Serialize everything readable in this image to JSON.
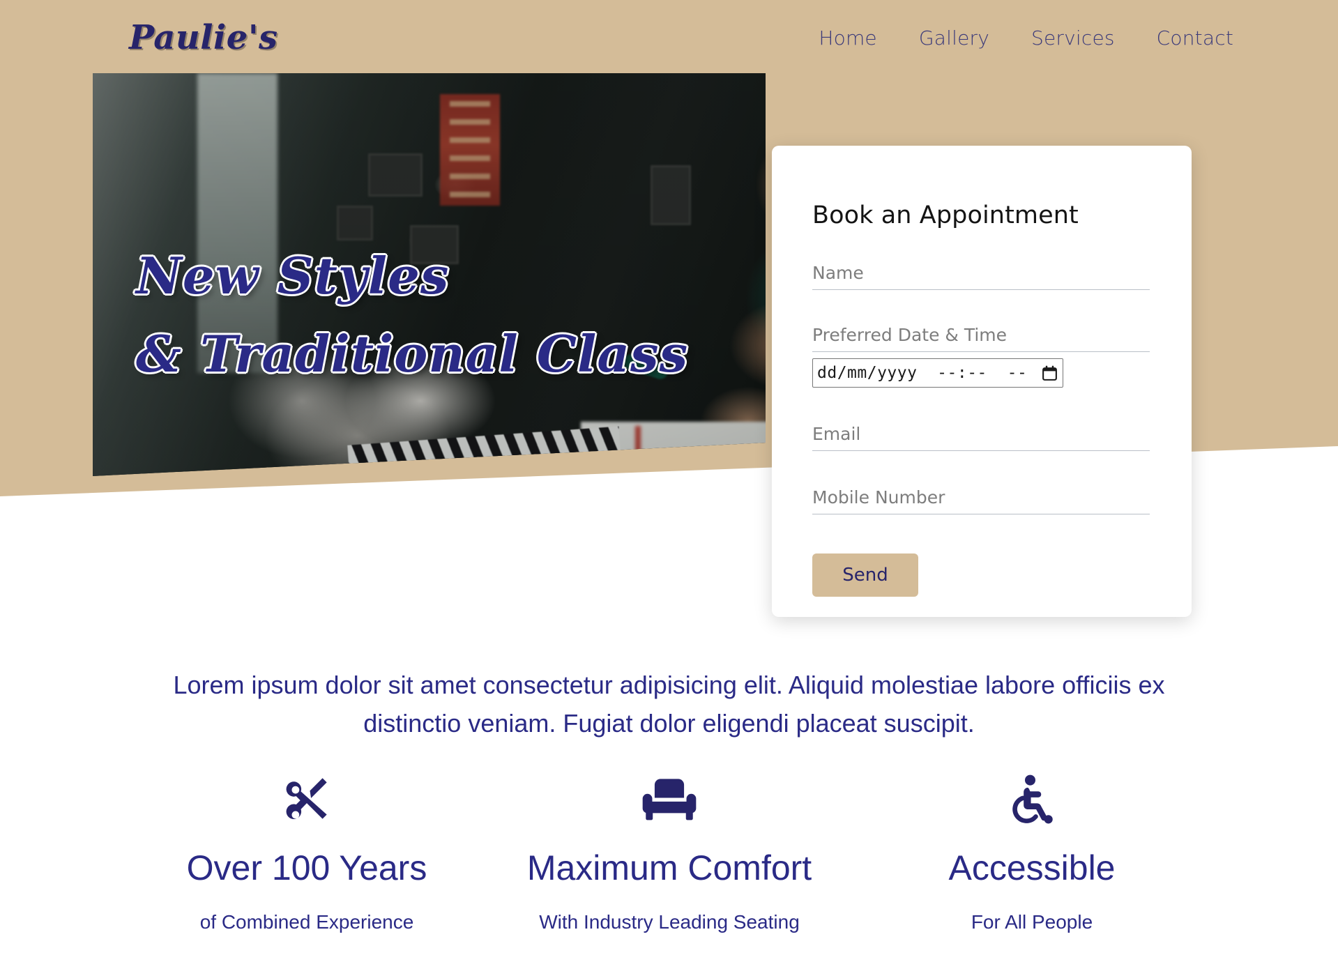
{
  "brand": {
    "logo": "Paulie's"
  },
  "nav": {
    "items": [
      {
        "label": "Home"
      },
      {
        "label": "Gallery"
      },
      {
        "label": "Services"
      },
      {
        "label": "Contact"
      }
    ]
  },
  "hero": {
    "title": "New Styles\n& Traditional Class",
    "image_alt": "barber shaving an older client in a barbershop"
  },
  "booking": {
    "title": "Book an Appointment",
    "name_placeholder": "Name",
    "datetime_label": "Preferred Date & Time",
    "datetime_value": "dd/mm/yyyy  --:--  --",
    "email_placeholder": "Email",
    "mobile_placeholder": "Mobile Number",
    "send_label": "Send"
  },
  "intro": {
    "text": "Lorem ipsum dolor sit amet consectetur adipisicing elit. Aliquid molestiae labore officiis ex distinctio veniam. Fugiat dolor eligendi placeat suscipit."
  },
  "features": [
    {
      "icon": "scissors-icon",
      "title": "Over 100 Years",
      "subtitle": "of Combined Experience"
    },
    {
      "icon": "couch-icon",
      "title": "Maximum Comfort",
      "subtitle": "With Industry Leading Seating"
    },
    {
      "icon": "wheelchair-icon",
      "title": "Accessible",
      "subtitle": "For All People"
    }
  ],
  "colors": {
    "tan": "#d4bc98",
    "navy": "#2a2a86",
    "logo_navy": "#27246a",
    "card_bg": "#ffffff",
    "page_bg": "#ffffff"
  }
}
